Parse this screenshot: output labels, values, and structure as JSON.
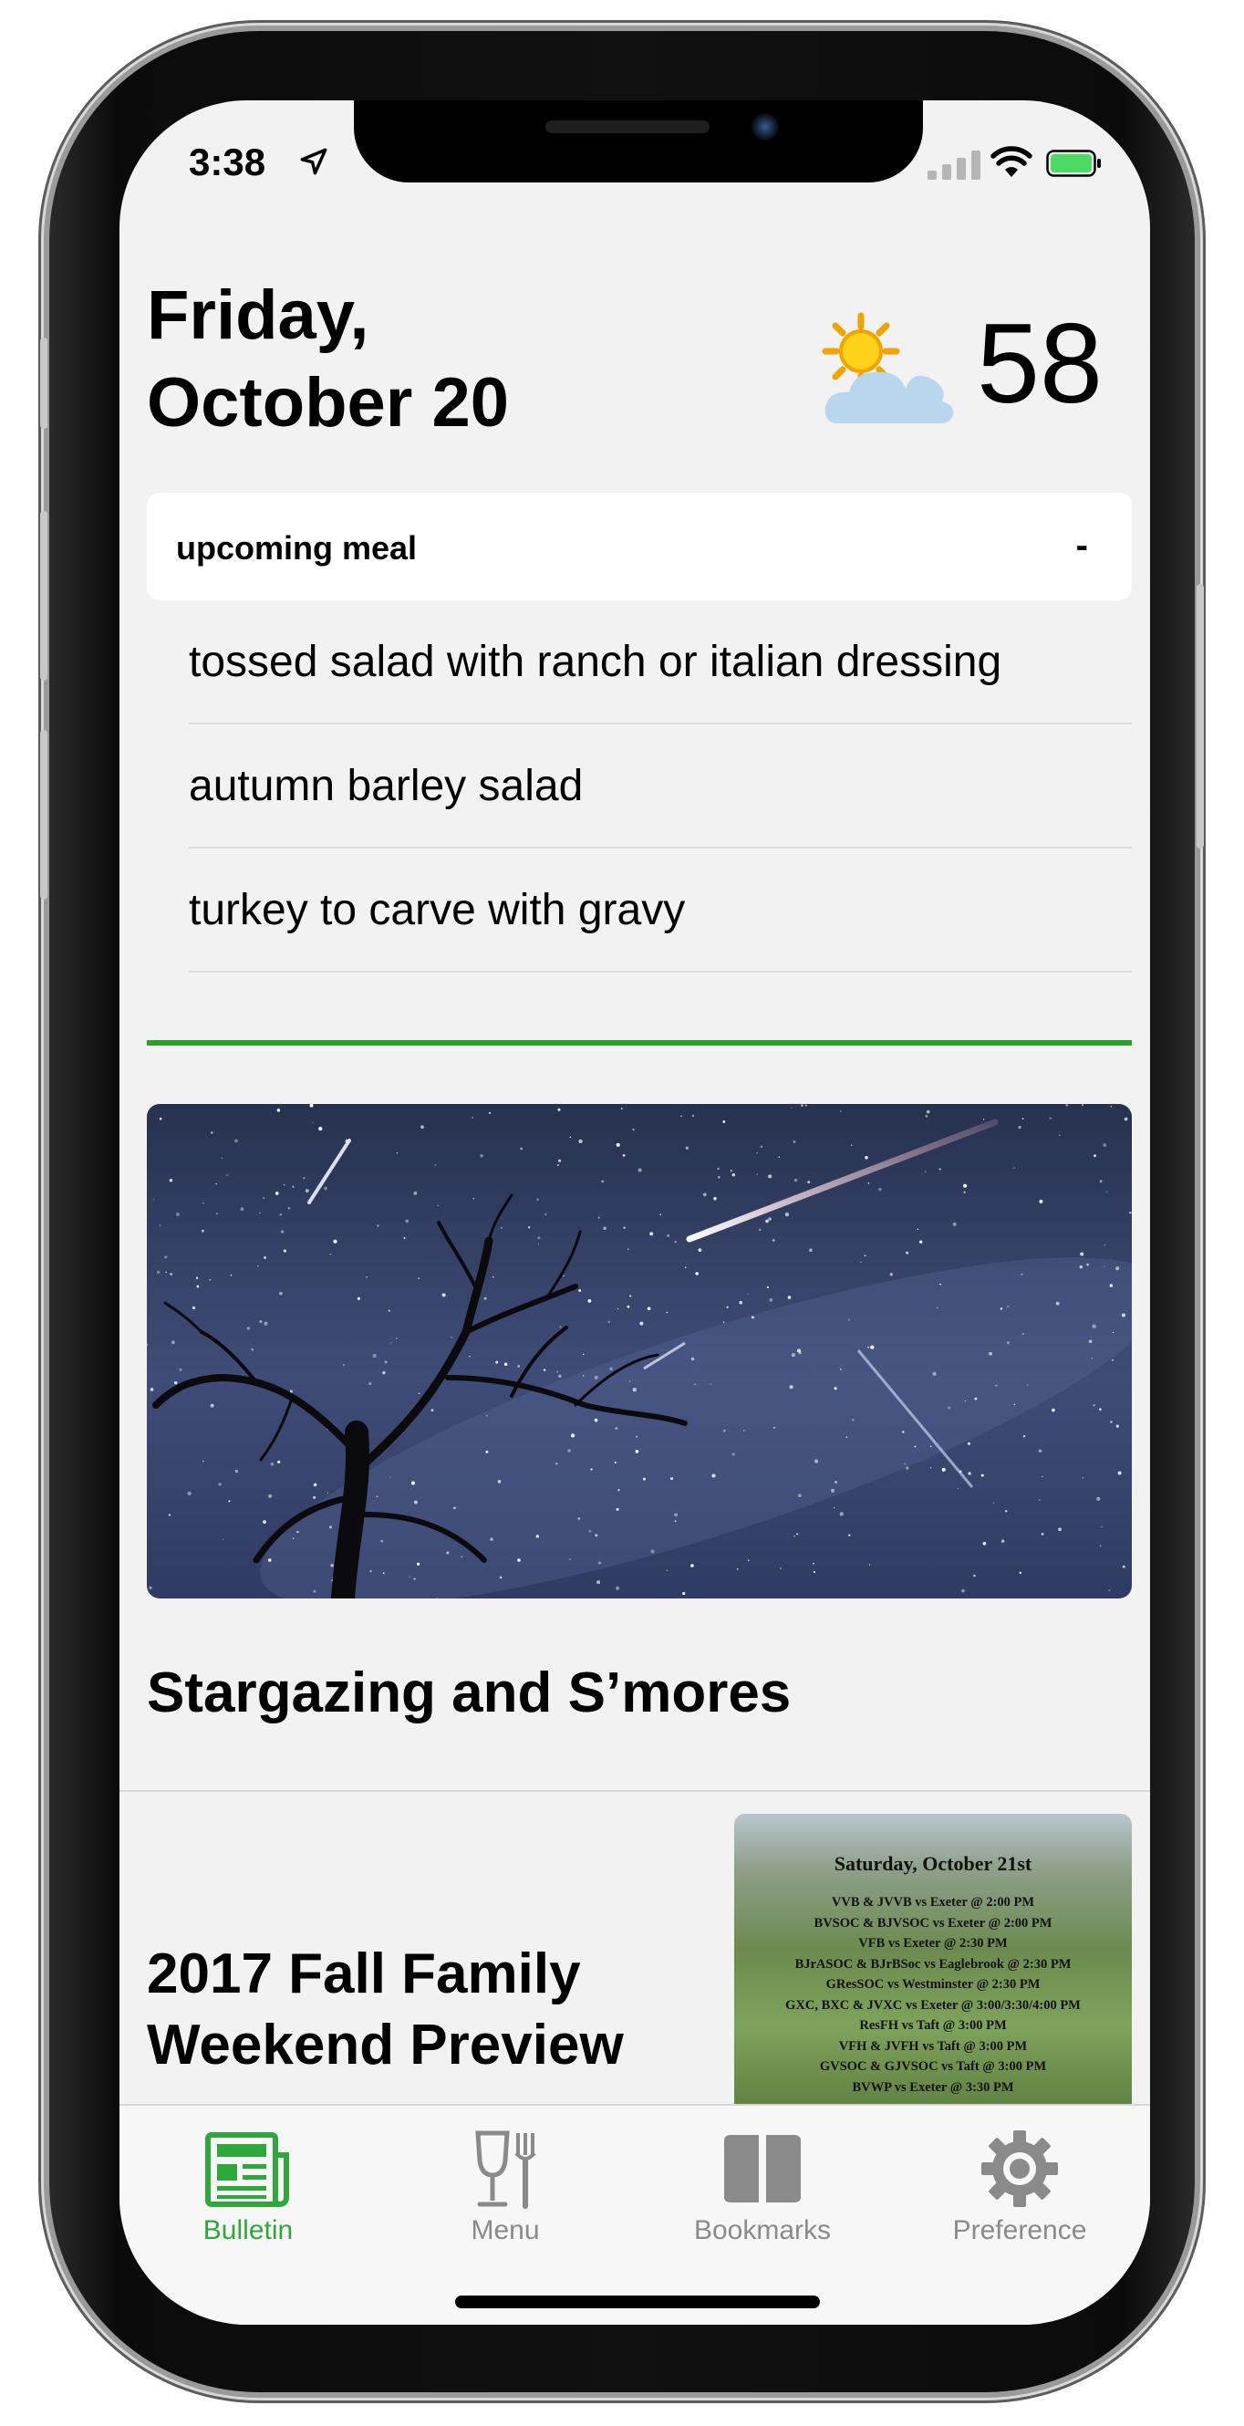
{
  "status_bar": {
    "time": "3:38"
  },
  "header": {
    "date_line1": "Friday,",
    "date_line2": "October 20",
    "temperature": "58",
    "weather_icon": "partly-cloudy-icon"
  },
  "meal": {
    "title": "upcoming meal",
    "collapse_label": "-",
    "items": [
      "tossed salad with ranch or italian dressing",
      "autumn barley salad",
      "turkey to carve with gravy"
    ]
  },
  "events": [
    {
      "title": "Stargazing and S’mores"
    },
    {
      "title_line1": "2017 Fall Family",
      "title_line2": "Weekend Preview",
      "thumbnail": {
        "heading": "Saturday, October 21st",
        "lines": [
          "VVB & JVVB  vs Exeter @ 2:00 PM",
          "BVSOC & BJVSOC vs Exeter @ 2:00 PM",
          "VFB vs Exeter @ 2:30 PM",
          "BJrASOC & BJrBSoc vs Eaglebrook @ 2:30 PM",
          "GResSOC vs  Westminster @ 2:30 PM",
          "GXC, BXC & JVXC vs Exeter @ 3:00/3:30/4:00 PM",
          "ResFH vs Taft @ 3:00 PM",
          "VFH & JVFH vs Taft @ 3:00 PM",
          "GVSOC & GJVSOC vs Taft @ 3:00 PM",
          "BVWP vs Exeter @ 3:30 PM"
        ]
      }
    }
  ],
  "tabs": [
    {
      "label": "Bulletin",
      "icon": "newspaper-icon",
      "active": true
    },
    {
      "label": "Menu",
      "icon": "fork-knife-icon",
      "active": false
    },
    {
      "label": "Bookmarks",
      "icon": "book-icon",
      "active": false
    },
    {
      "label": "Preference",
      "icon": "gear-icon",
      "active": false
    }
  ],
  "colors": {
    "accent": "#2ea83b",
    "divider_green": "#2aa22a",
    "inactive": "#8a8a8a",
    "background": "#f2f2f2"
  }
}
